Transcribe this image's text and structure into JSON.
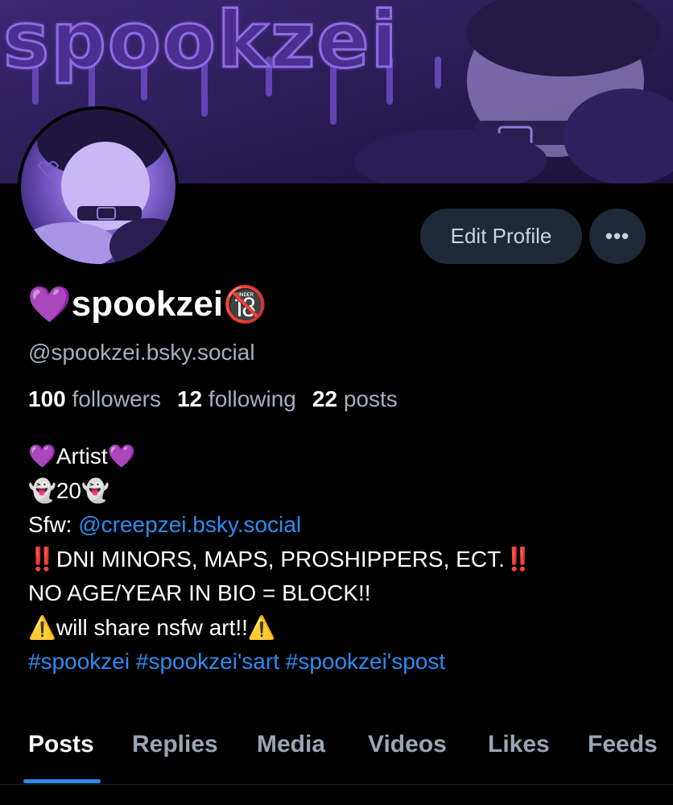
{
  "banner": {
    "title_art": "spookzei",
    "colors": {
      "bg": "#2a1a52",
      "accent": "#8f6ae0"
    }
  },
  "profile": {
    "name_prefix_emoji": "💜",
    "name": "spookzei",
    "name_suffix_emoji": "🔞",
    "handle": "@spookzei.bsky.social",
    "actions": {
      "edit_label": "Edit Profile",
      "more_label": "•••"
    },
    "stats": {
      "followers_count": "100",
      "followers_label": "followers",
      "following_count": "12",
      "following_label": "following",
      "posts_count": "22",
      "posts_label": "posts"
    },
    "bio": {
      "line1": "💜Artist💜",
      "line2": "👻20👻",
      "line3_prefix": "Sfw: ",
      "line3_link": "@creepzei.bsky.social",
      "line4": "‼️DNI MINORS, MAPS, PROSHIPPERS, ECT.‼️",
      "line5": "NO AGE/YEAR IN BIO = BLOCK!!",
      "line6": "⚠️will share nsfw art!!⚠️",
      "hashtags": [
        "#spookzei",
        "#spookzei'sart",
        "#spookzei'spost"
      ]
    }
  },
  "tabs": [
    {
      "label": "Posts",
      "active": true
    },
    {
      "label": "Replies",
      "active": false
    },
    {
      "label": "Media",
      "active": false
    },
    {
      "label": "Videos",
      "active": false
    },
    {
      "label": "Likes",
      "active": false
    },
    {
      "label": "Feeds",
      "active": false
    }
  ],
  "colors": {
    "background": "#000000",
    "link": "#2d8bf0",
    "muted": "#a3b0be",
    "button_bg": "#1e2937"
  }
}
